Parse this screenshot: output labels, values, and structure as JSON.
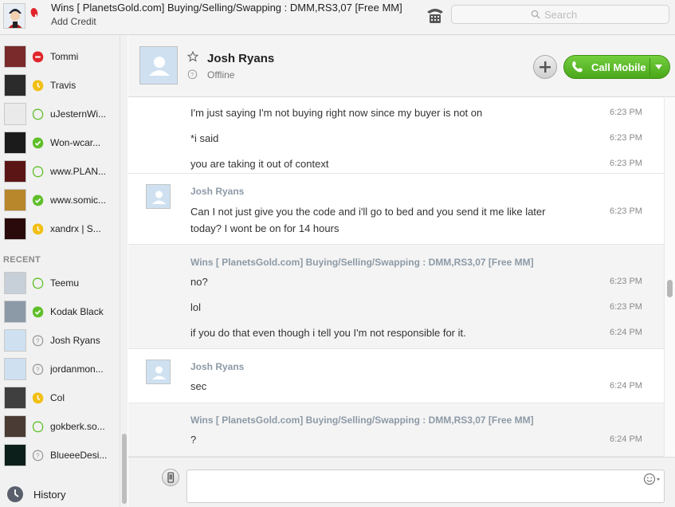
{
  "topbar": {
    "account_title": "Wins [ PlanetsGold.com] Buying/Selling/Swapping : DMM,RS3,07 [Free MM]",
    "credit_label": "Add Credit",
    "search_placeholder": "Search"
  },
  "sidebar": {
    "contacts_top": [
      {
        "name": "Tommi",
        "status": "dnd"
      },
      {
        "name": "Travis",
        "status": "away"
      },
      {
        "name": "uJesternWi...",
        "status": "online-idle"
      },
      {
        "name": "Won-wcar...",
        "status": "online"
      },
      {
        "name": "www.PLAN...",
        "status": "online-idle"
      },
      {
        "name": "www.somic...",
        "status": "online"
      },
      {
        "name": "xandrx | S...",
        "status": "away"
      }
    ],
    "recent_label": "RECENT",
    "contacts_recent": [
      {
        "name": "Teemu",
        "status": "online-idle"
      },
      {
        "name": "Kodak Black",
        "status": "online"
      },
      {
        "name": "Josh Ryans",
        "status": "offline"
      },
      {
        "name": "jordanmon...",
        "status": "offline"
      },
      {
        "name": "Col",
        "status": "away"
      },
      {
        "name": "gokberk.so...",
        "status": "online-idle"
      },
      {
        "name": "BlueeeDesi...",
        "status": "offline"
      }
    ],
    "history_label": "History"
  },
  "chat": {
    "peer_name": "Josh Ryans",
    "peer_status": "Offline",
    "call_label": "Call Mobile",
    "groups": [
      {
        "sender": "",
        "messages": [
          {
            "text": "I'm just saying I'm not buying right now since my buyer is not on",
            "time": "6:23 PM"
          },
          {
            "text": "*i said",
            "time": "6:23 PM"
          },
          {
            "text": "you are taking it out of context",
            "time": "6:23 PM"
          }
        ]
      },
      {
        "sender": "Josh Ryans",
        "messages": [
          {
            "text": "Can I not just give you the code and i'll go to bed and you send it me like later today? I wont be on for 14 hours",
            "time": "6:23 PM"
          }
        ]
      },
      {
        "sender": "Wins [ PlanetsGold.com] Buying/Selling/Swapping : DMM,RS3,07 [Free MM]",
        "messages": [
          {
            "text": "no?",
            "time": "6:23 PM"
          },
          {
            "text": "lol",
            "time": "6:23 PM"
          },
          {
            "text": "if you do that even though i tell you I'm not responsible for it.",
            "time": "6:24 PM"
          }
        ]
      },
      {
        "sender": "Josh Ryans",
        "messages": [
          {
            "text": "sec",
            "time": "6:24 PM"
          }
        ]
      },
      {
        "sender": "Wins [ PlanetsGold.com] Buying/Selling/Swapping : DMM,RS3,07 [Free MM]",
        "messages": [
          {
            "text": "?",
            "time": "6:24 PM"
          }
        ]
      }
    ],
    "composer_value": ""
  },
  "colors": {
    "online": "#5fbf2a",
    "away": "#f2bf15",
    "dnd": "#e0262b",
    "call_green": "#5ab82a",
    "sender_grey": "#8d9aa6"
  }
}
